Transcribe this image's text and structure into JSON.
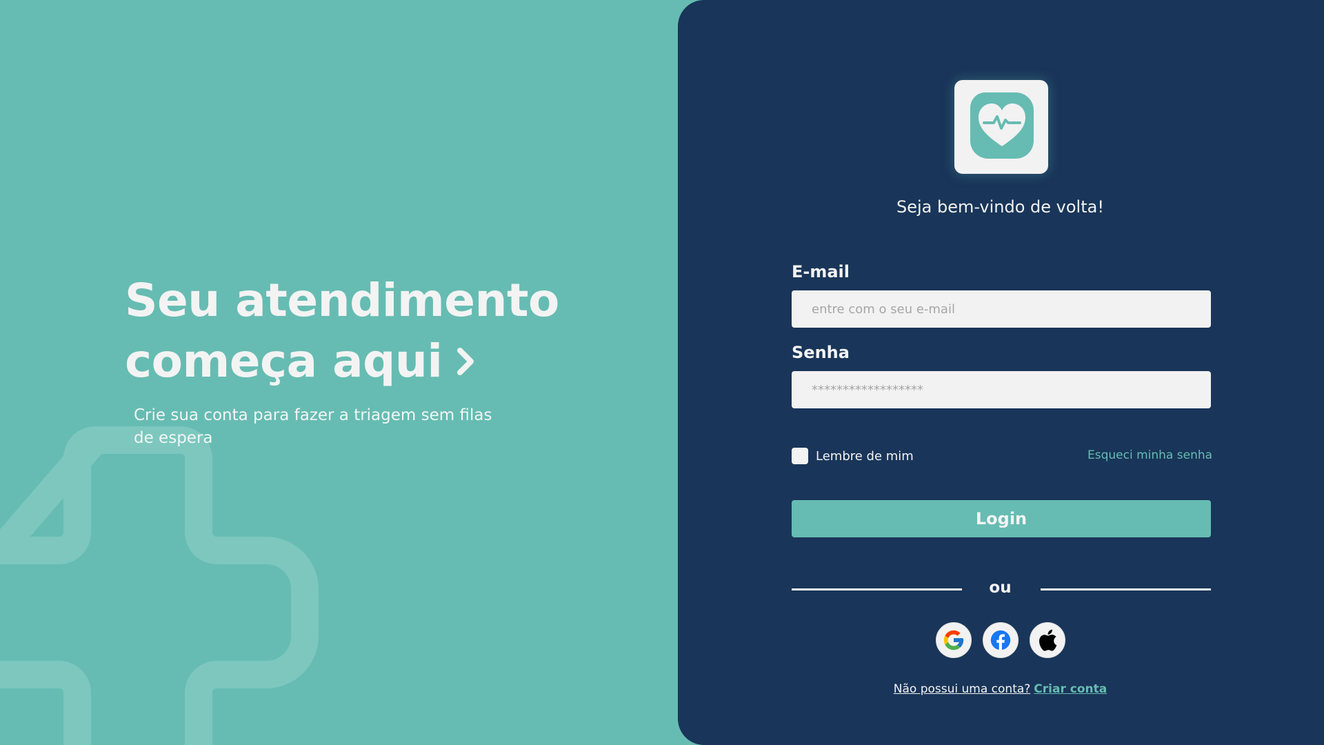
{
  "hero": {
    "title_line1": "Seu atendimento",
    "title_line2": "começa aqui",
    "subtitle": "Crie sua conta para fazer a triagem sem filas de espera"
  },
  "login": {
    "welcome": "Seja bem-vindo de volta!",
    "email_label": "E-mail",
    "email_placeholder": "entre com o seu e-mail",
    "password_label": "Senha",
    "password_placeholder": "******************",
    "remember_label": "Lembre de mim",
    "forgot_label": "Esqueci minha senha",
    "login_button": "Login",
    "divider": "ou",
    "no_account": "Não possui uma conta?",
    "create_account": "Criar conta"
  },
  "social": [
    "google-icon",
    "facebook-icon",
    "apple-icon"
  ],
  "colors": {
    "teal": "#66bcb2",
    "navy": "#193559",
    "light": "#f2f2f2"
  }
}
